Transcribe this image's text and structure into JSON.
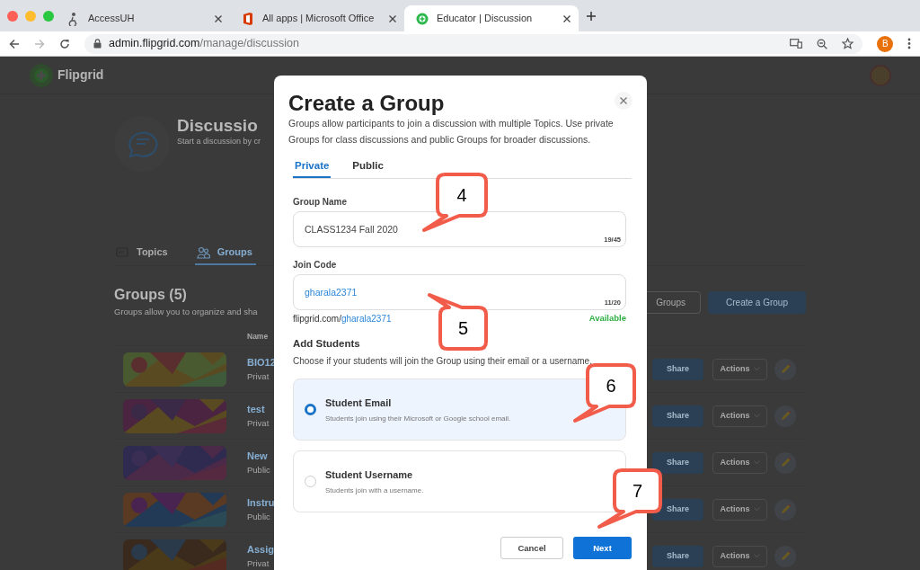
{
  "browser": {
    "tabs": [
      {
        "title": "AccessUH",
        "selected": false
      },
      {
        "title": "All apps | Microsoft Office",
        "selected": false
      },
      {
        "title": "Educator | Discussion",
        "selected": true
      }
    ],
    "url": {
      "host": "admin.flipgrid.com",
      "path": "/manage/discussion"
    },
    "profile": "B"
  },
  "app": {
    "brand": "Flipgrid",
    "hero": {
      "title": "Discussio",
      "subtitle": "Start a discussion by cr"
    },
    "tabs": [
      {
        "label": "Topics",
        "selected": false
      },
      {
        "label": "Groups",
        "selected": true
      }
    ],
    "section": {
      "title": "Groups (5)",
      "description": "Groups allow you to organize and sha",
      "buttons": [
        {
          "label": "Groups",
          "kind": "outline"
        },
        {
          "label": "Create a Group",
          "kind": "primary"
        }
      ]
    },
    "table": {
      "columns": [
        "Name"
      ],
      "rows": [
        {
          "name": "BIO12",
          "visibility": "Privat",
          "share": "Share",
          "actions": "Actions"
        },
        {
          "name": "test",
          "visibility": "Privat",
          "share": "Share",
          "actions": "Actions"
        },
        {
          "name": "New",
          "visibility": "Public",
          "share": "Share",
          "actions": "Actions"
        },
        {
          "name": "Instru",
          "visibility": "Public",
          "share": "Share",
          "actions": "Actions"
        },
        {
          "name": "Assig",
          "visibility": "Privat",
          "share": "Share",
          "actions": "Actions"
        }
      ]
    }
  },
  "dialog": {
    "title": "Create a Group",
    "description": "Groups allow participants to join a discussion with multiple Topics. Use private Groups for class discussions and public Groups for broader discussions.",
    "tabs": [
      {
        "label": "Private",
        "selected": true
      },
      {
        "label": "Public",
        "selected": false
      }
    ],
    "fields": [
      {
        "label": "Group Name",
        "value": "CLASS1234 Fall 2020",
        "counter": "19/45",
        "kind": "text"
      },
      {
        "label": "Join Code",
        "value": "gharala2371",
        "counter": "11/20",
        "kind": "code"
      }
    ],
    "link": {
      "prefix": "flipgrid.com/",
      "code": "gharala2371",
      "status": "Available"
    },
    "students": {
      "title": "Add Students",
      "description": "Choose if your students will join the Group using their email or a username.",
      "options": [
        {
          "title": "Student Email",
          "description": "Students join using their Microsoft or Google school email.",
          "selected": true
        },
        {
          "title": "Student Username",
          "description": "Students join with a username.",
          "selected": false
        }
      ]
    },
    "buttons": [
      {
        "label": "Cancel",
        "kind": "secondary"
      },
      {
        "label": "Next",
        "kind": "primary"
      }
    ]
  },
  "callouts": [
    {
      "number": "4"
    },
    {
      "number": "5"
    },
    {
      "number": "6"
    },
    {
      "number": "7"
    }
  ]
}
